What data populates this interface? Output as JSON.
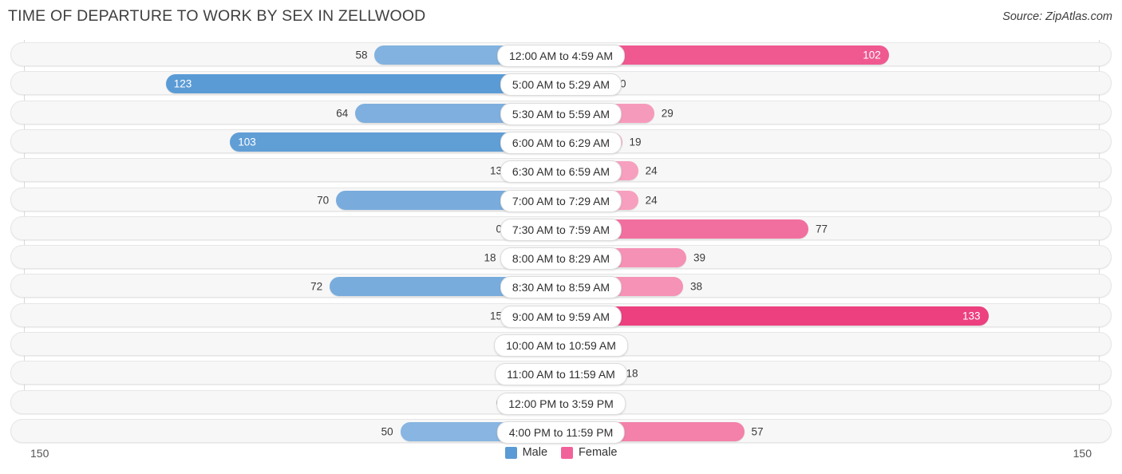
{
  "header": {
    "title": "TIME OF DEPARTURE TO WORK BY SEX IN ZELLWOOD",
    "source": "Source: ZipAtlas.com"
  },
  "axis": {
    "left_max": "150",
    "right_max": "150"
  },
  "legend": {
    "items": [
      {
        "label": "Male",
        "color": "#5b9bd5"
      },
      {
        "label": "Female",
        "color": "#f2629a"
      }
    ]
  },
  "chart_data": {
    "type": "bar",
    "title": "TIME OF DEPARTURE TO WORK BY SEX IN ZELLWOOD",
    "subtitle": "Source: ZipAtlas.com",
    "orientation": "horizontal-diverging",
    "xlabel": "",
    "ylabel": "",
    "xlim": [
      150,
      150
    ],
    "axis_max": 150,
    "grid": false,
    "legend_position": "bottom-center",
    "categories": [
      "12:00 AM to 4:59 AM",
      "5:00 AM to 5:29 AM",
      "5:30 AM to 5:59 AM",
      "6:00 AM to 6:29 AM",
      "6:30 AM to 6:59 AM",
      "7:00 AM to 7:29 AM",
      "7:30 AM to 7:59 AM",
      "8:00 AM to 8:29 AM",
      "8:30 AM to 8:59 AM",
      "9:00 AM to 9:59 AM",
      "10:00 AM to 10:59 AM",
      "11:00 AM to 11:59 AM",
      "12:00 PM to 3:59 PM",
      "4:00 PM to 11:59 PM"
    ],
    "series": [
      {
        "name": "Male",
        "color": "#5b9bd5",
        "values": [
          58,
          123,
          64,
          103,
          13,
          70,
          0,
          18,
          72,
          15,
          0,
          0,
          0,
          50
        ]
      },
      {
        "name": "Female",
        "color": "#f2629a",
        "values": [
          102,
          0,
          29,
          19,
          24,
          24,
          77,
          39,
          38,
          133,
          0,
          18,
          0,
          57
        ]
      }
    ]
  },
  "rows": [
    {
      "label": "12:00 AM to 4:59 AM",
      "male": "58",
      "female": "102"
    },
    {
      "label": "5:00 AM to 5:29 AM",
      "male": "123",
      "female": "0"
    },
    {
      "label": "5:30 AM to 5:59 AM",
      "male": "64",
      "female": "29"
    },
    {
      "label": "6:00 AM to 6:29 AM",
      "male": "103",
      "female": "19"
    },
    {
      "label": "6:30 AM to 6:59 AM",
      "male": "13",
      "female": "24"
    },
    {
      "label": "7:00 AM to 7:29 AM",
      "male": "70",
      "female": "24"
    },
    {
      "label": "7:30 AM to 7:59 AM",
      "male": "0",
      "female": "77"
    },
    {
      "label": "8:00 AM to 8:29 AM",
      "male": "18",
      "female": "39"
    },
    {
      "label": "8:30 AM to 8:59 AM",
      "male": "72",
      "female": "38"
    },
    {
      "label": "9:00 AM to 9:59 AM",
      "male": "15",
      "female": "133"
    },
    {
      "label": "10:00 AM to 10:59 AM",
      "male": "0",
      "female": "0"
    },
    {
      "label": "11:00 AM to 11:59 AM",
      "male": "0",
      "female": "18"
    },
    {
      "label": "12:00 PM to 3:59 PM",
      "male": "0",
      "female": "0"
    },
    {
      "label": "4:00 PM to 11:59 PM",
      "male": "50",
      "female": "57"
    }
  ]
}
